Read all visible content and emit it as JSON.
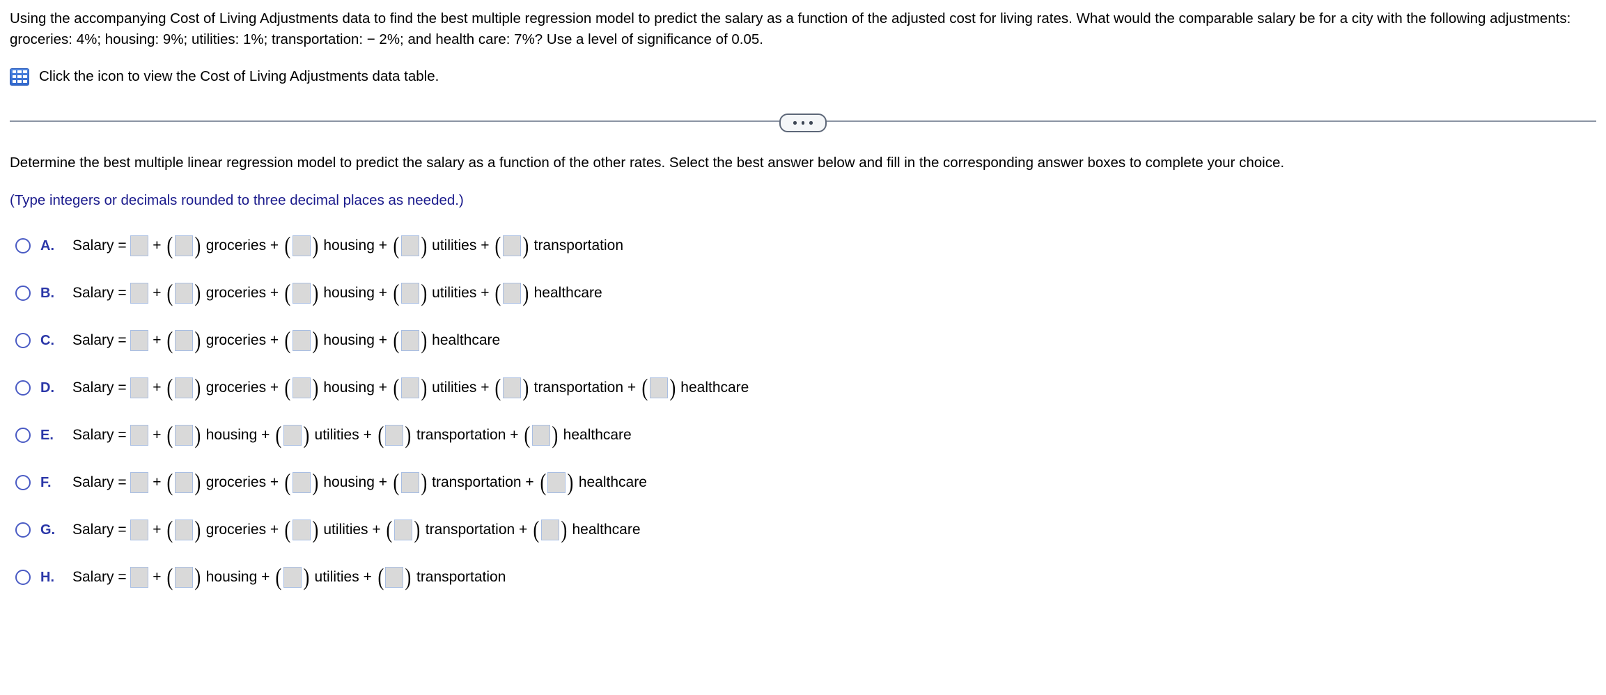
{
  "stem": {
    "text": "Using the accompanying Cost of Living Adjustments data to find the best multiple regression model to predict the salary as a function of the adjusted cost for living rates. What would the comparable salary be for a city with the following adjustments: groceries: 4%; housing: 9%; utilities: 1%; transportation:  − 2%; and health care: 7%? Use a level of significance of 0.05."
  },
  "data_link": {
    "icon": "table-grid-icon",
    "text": "Click the icon to view the Cost of Living Adjustments data table."
  },
  "divider": {
    "expand_button": "ellipsis-button",
    "dots": [
      "•",
      "•",
      "•"
    ]
  },
  "question": {
    "text": "Determine the best multiple linear regression model to predict the salary as a function of the other rates. Select the best answer below and fill in the corresponding answer boxes to complete your choice.",
    "hint": "(Type integers or decimals rounded to three decimal places as needed.)"
  },
  "colors": {
    "accent_blue": "#2b37a8",
    "radio_blue": "#4a5bc4",
    "hint_blue": "#1a1a8c",
    "input_fill": "#d9d9d9",
    "input_border": "#a9bee2",
    "icon_blue": "#3b72d4",
    "rule_gray": "#8b94a3"
  },
  "labels": {
    "salary_eq": "Salary = ",
    "plus": " + ",
    "paren_open": "(",
    "paren_close": ")",
    "intercept_placeholder": "",
    "coefficient_placeholder": ""
  },
  "options": [
    {
      "letter": "A.",
      "selected": false,
      "terms": [
        "groceries",
        "housing",
        "utilities",
        "transportation"
      ]
    },
    {
      "letter": "B.",
      "selected": false,
      "terms": [
        "groceries",
        "housing",
        "utilities",
        "healthcare"
      ]
    },
    {
      "letter": "C.",
      "selected": false,
      "terms": [
        "groceries",
        "housing",
        "healthcare"
      ]
    },
    {
      "letter": "D.",
      "selected": false,
      "terms": [
        "groceries",
        "housing",
        "utilities",
        "transportation",
        "healthcare"
      ]
    },
    {
      "letter": "E.",
      "selected": false,
      "terms": [
        "housing",
        "utilities",
        "transportation",
        "healthcare"
      ]
    },
    {
      "letter": "F.",
      "selected": false,
      "terms": [
        "groceries",
        "housing",
        "transportation",
        "healthcare"
      ]
    },
    {
      "letter": "G.",
      "selected": false,
      "terms": [
        "groceries",
        "utilities",
        "transportation",
        "healthcare"
      ]
    },
    {
      "letter": "H.",
      "selected": false,
      "terms": [
        "housing",
        "utilities",
        "transportation"
      ]
    }
  ]
}
